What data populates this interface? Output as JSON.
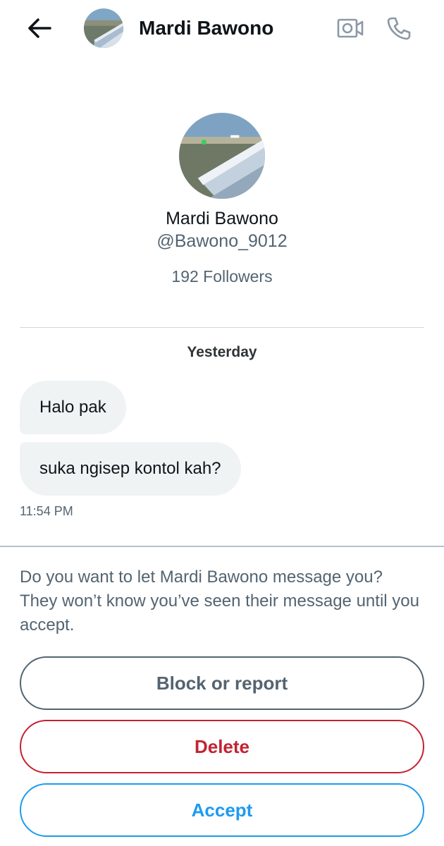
{
  "header": {
    "name": "Mardi Bawono",
    "back_icon": "arrow-left-icon",
    "video_icon": "video-camera-icon",
    "phone_icon": "phone-icon"
  },
  "profile": {
    "name": "Mardi Bawono",
    "handle": "@Bawono_9012",
    "followers": "192 Followers"
  },
  "conversation": {
    "date_label": "Yesterday",
    "messages": [
      {
        "text": "Halo pak"
      },
      {
        "text": "suka ngisep kontol kah?"
      }
    ],
    "timestamp": "11:54 PM"
  },
  "request": {
    "prompt": "Do you want to let Mardi Bawono message you? They won’t know you’ve seen their message until you accept.",
    "block_label": "Block or report",
    "delete_label": "Delete",
    "accept_label": "Accept"
  },
  "colors": {
    "text_primary": "#0f1419",
    "text_secondary": "#536471",
    "bubble_bg": "#eff3f4",
    "delete_red": "#c42231",
    "accept_blue": "#1d9bf0",
    "divider": "#cfd9de"
  }
}
